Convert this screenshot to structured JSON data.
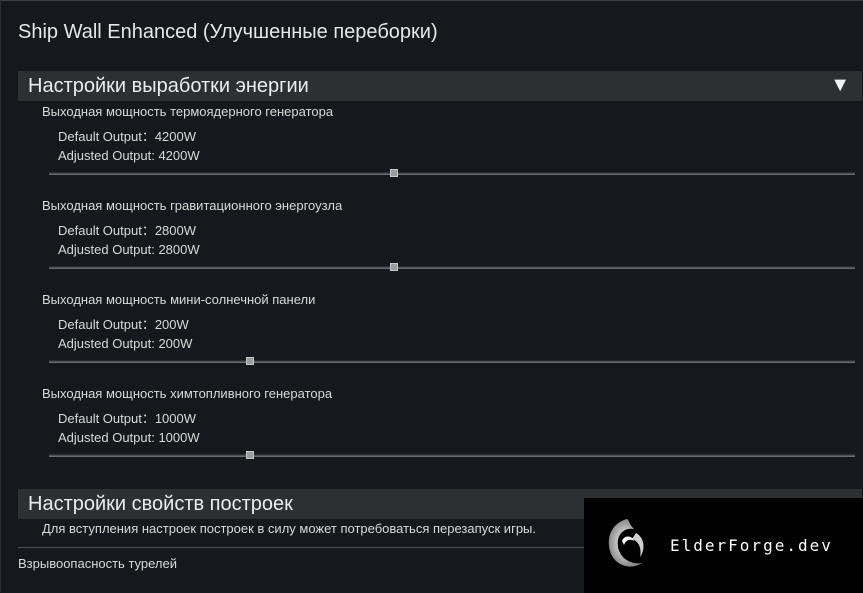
{
  "window": {
    "title": "Ship Wall Enhanced (Улучшенные переборки)"
  },
  "section_power": {
    "header": "Настройки выработки энергии",
    "arrow": "▼",
    "settings": [
      {
        "title": "Выходная мощность термоядерного генератора",
        "default_line": "Default Output：4200W",
        "adjusted_line": "Adjusted Output: 4200W",
        "slider_fraction": 0.428
      },
      {
        "title": "Выходная мощность гравитационного энергоузла",
        "default_line": "Default Output：2800W",
        "adjusted_line": "Adjusted Output: 2800W",
        "slider_fraction": 0.428
      },
      {
        "title": "Выходная мощность мини-солнечной панели",
        "default_line": "Default Output：200W",
        "adjusted_line": "Adjusted Output: 200W",
        "slider_fraction": 0.249
      },
      {
        "title": "Выходная мощность химтопливного генератора",
        "default_line": "Default Output：1000W",
        "adjusted_line": "Adjusted Output: 1000W",
        "slider_fraction": 0.249
      }
    ]
  },
  "section_build": {
    "header": "Настройки свойств построек",
    "hint": "Для вступления настроек построек в силу может потребоваться перезапуск игры.",
    "first_setting": "Взрывоопасность турелей"
  },
  "watermark": {
    "text": "ElderForge.dev"
  }
}
